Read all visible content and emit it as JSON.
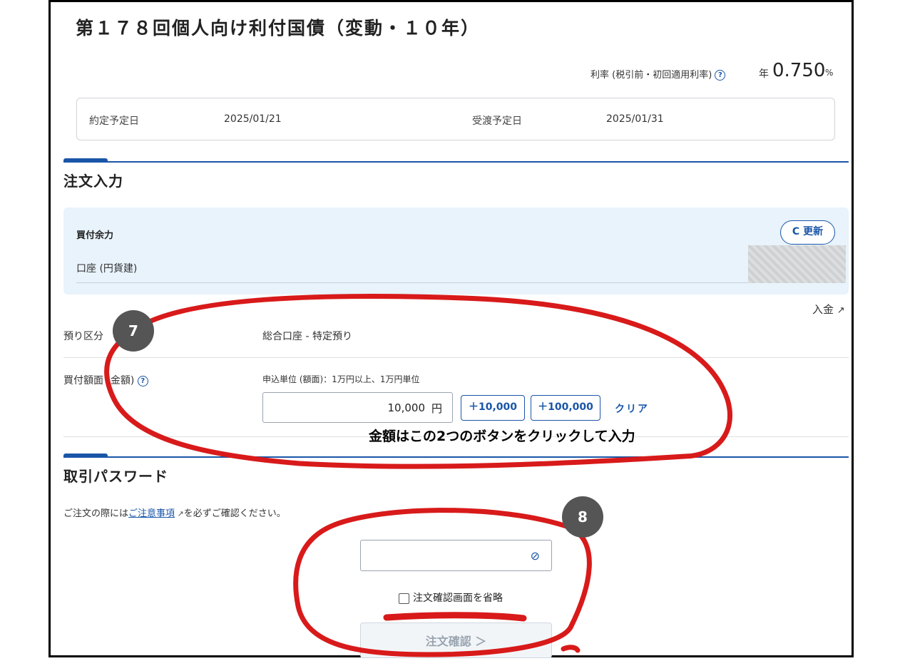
{
  "header": {
    "title": "第１７８回個人向け利付国債（変動・１０年）",
    "rate_label": "利率 (税引前・初回適用利率)",
    "help_icon": "?",
    "rate_year": "年",
    "rate_value": "0.750",
    "rate_unit": "%"
  },
  "dates": {
    "contract_label": "約定予定日",
    "contract_value": "2025/01/21",
    "delivery_label": "受渡予定日",
    "delivery_value": "2025/01/31"
  },
  "order": {
    "section_title": "注文入力",
    "buying_power_title": "買付余力",
    "account_label": "口座 (円貨建)",
    "refresh_label": "C 更新",
    "deposit_link": "入金",
    "custody_label": "預り区分",
    "custody_value": "総合口座 - 特定預り",
    "amount_label": "買付額面 (金額)",
    "unit_note": "申込単位 (額面)：1万円以上、1万円単位",
    "amount_value": "10,000",
    "amount_unit": "円",
    "plus_10000": "＋10,000",
    "plus_100000": "＋100,000",
    "clear": "クリア"
  },
  "password": {
    "section_title": "取引パスワード",
    "notice_before": "ご注文の際には",
    "notice_link": "ご注意事項",
    "notice_after": "を必ずご確認ください。",
    "skip_label": "注文確認画面を省略",
    "confirm_button": "注文確認 ＞"
  },
  "annotations": {
    "badge_7": "7",
    "badge_8": "8",
    "note": "金額はこの2つのボタンをクリックして入力",
    "color": "#d81a1a"
  }
}
